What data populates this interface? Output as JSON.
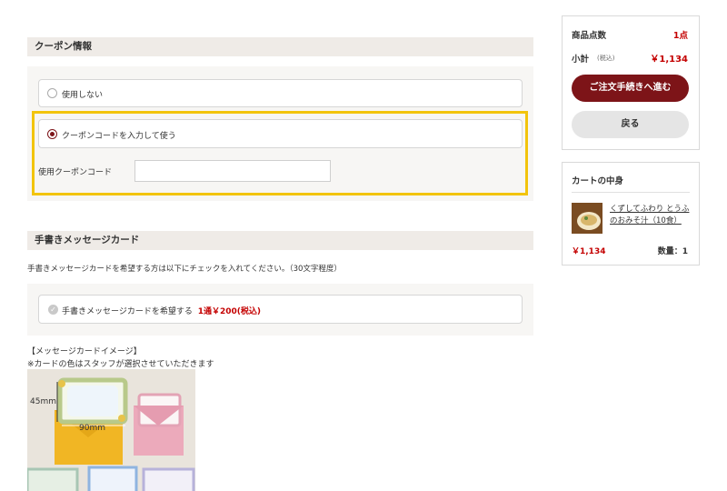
{
  "coupon": {
    "heading": "クーポン情報",
    "option_none": "使用しない",
    "option_use": "クーポンコードを入力して使う",
    "code_label": "使用クーポンコード",
    "code_value": ""
  },
  "message_card": {
    "heading": "手書きメッセージカード",
    "description": "手書きメッセージカードを希望する方は以下にチェックを入れてください。（30文字程度）",
    "checkbox_label": "手書きメッセージカードを希望する",
    "price_note": "1通￥200(税込)",
    "image_caption_1": "【メッセージカードイメージ】",
    "image_caption_2": "※カードの色はスタッフが選択させていただきます",
    "dim_height": "45mm",
    "dim_width": "90mm"
  },
  "summary": {
    "count_label": "商品点数",
    "count_value": "1点",
    "subtotal_label": "小計",
    "tax_note": "(税込)",
    "subtotal_value": "￥1,134",
    "checkout_button": "ご注文手続きへ進む",
    "back_button": "戻る"
  },
  "cart": {
    "heading": "カートの中身",
    "item_name": "くずしてふわり とうふのおみそ汁（10食）",
    "item_price": "￥1,134",
    "item_qty": "数量：1"
  },
  "colors": {
    "accent_dark_red": "#7d1418",
    "price_red": "#c40000",
    "highlight_yellow": "#f2c40c",
    "section_bg": "#efebe7"
  }
}
